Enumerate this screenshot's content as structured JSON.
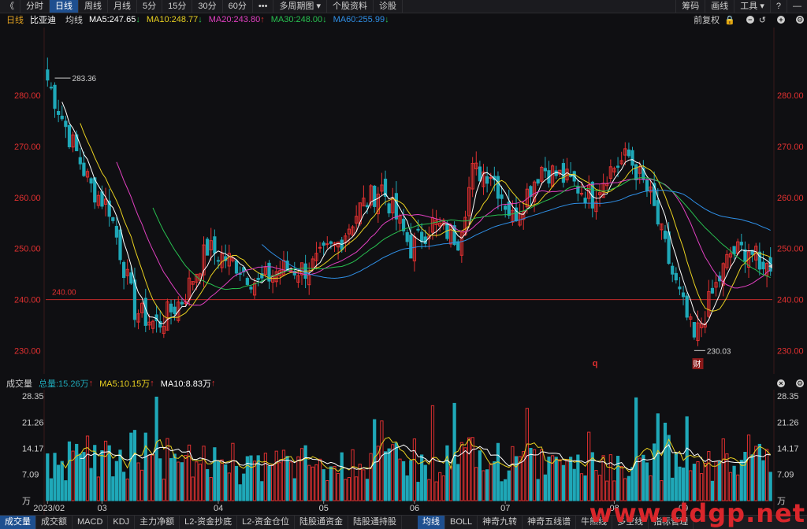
{
  "toolbar": {
    "back_icon": "double-chevron-left-icon",
    "items": [
      "分时",
      "日线",
      "周线",
      "月线",
      "5分",
      "15分",
      "30分",
      "60分",
      "•••",
      "多周期图 ▾",
      "个股资料",
      "诊股"
    ],
    "active": "日线",
    "right_items": [
      "筹码",
      "画线",
      "工具 ▾"
    ],
    "right_icons": [
      "help-icon",
      "minimize-icon"
    ]
  },
  "header": {
    "period": "日线",
    "name": "比亚迪",
    "ma_label": "均线",
    "ma5": "MA5:247.65",
    "ma10": "MA10:248.77",
    "ma20": "MA20:243.80",
    "ma30": "MA30:248.00",
    "ma60": "MA60:255.99",
    "adjust": "前复权",
    "colors": {
      "ma5": "#ffffff",
      "ma10": "#e8d020",
      "ma20": "#e040c0",
      "ma30": "#28c050",
      "ma60": "#2f8fe6",
      "up": "#e03030",
      "down": "#1fa8b8"
    }
  },
  "price_axis": {
    "ticks": [
      "280.00",
      "270.00",
      "260.00",
      "250.00",
      "240.00",
      "230.00"
    ],
    "values": [
      280,
      270,
      260,
      250,
      240,
      230
    ],
    "ymin": 227,
    "ymax": 292,
    "ref_line": {
      "value": 240,
      "label": "240.00"
    },
    "high": {
      "value": 283.36,
      "label": "283.36"
    },
    "low": {
      "value": 230.03,
      "label": "230.03"
    },
    "markers": [
      "q",
      "财"
    ]
  },
  "volume": {
    "title": "成交量",
    "total": "总量:15.26万",
    "ma5": "MA5:10.15万",
    "ma10": "MA10:8.83万",
    "ticks": [
      "28.35",
      "21.26",
      "14.17",
      "7.09",
      "万"
    ],
    "values": [
      28.35,
      21.26,
      14.17,
      7.09,
      0
    ],
    "ymax": 28.35
  },
  "x_labels": [
    "2023/02",
    "03",
    "04",
    "05",
    "06",
    "07",
    "08",
    "09"
  ],
  "x_label_bars": [
    0,
    15,
    47,
    76,
    101,
    126,
    156,
    175
  ],
  "bottom_tabs": [
    "成交量",
    "成交额",
    "MACD",
    "KDJ",
    "主力净额",
    "L2-资金抄底",
    "L2-资金仓位",
    "陆股通资金",
    "陆股通持股"
  ],
  "bottom_tabs_right": [
    "均线",
    "BOLL",
    "神奇九转",
    "神奇五线谱",
    "牛熊线",
    "多空线",
    "指标管理"
  ],
  "bottom_active_left": "成交量",
  "bottom_active_right": "均线",
  "watermark": "www.ddgp.net",
  "chart_data": {
    "type": "candlestick",
    "title": "比亚迪 日线",
    "xlabel": "",
    "ylabel": "",
    "series": [
      {
        "name": "MA5",
        "last": 247.65
      },
      {
        "name": "MA10",
        "last": 248.77
      },
      {
        "name": "MA20",
        "last": 243.8
      },
      {
        "name": "MA30",
        "last": 248.0
      },
      {
        "name": "MA60",
        "last": 255.99
      }
    ],
    "ylim": [
      227,
      292
    ],
    "close_anchors": [
      [
        0,
        283
      ],
      [
        6,
        272
      ],
      [
        12,
        262
      ],
      [
        17,
        258
      ],
      [
        24,
        238
      ],
      [
        30,
        235
      ],
      [
        37,
        240
      ],
      [
        44,
        250
      ],
      [
        52,
        247
      ],
      [
        58,
        243
      ],
      [
        64,
        246
      ],
      [
        72,
        246
      ],
      [
        80,
        251
      ],
      [
        86,
        258
      ],
      [
        92,
        262
      ],
      [
        100,
        250
      ],
      [
        106,
        255
      ],
      [
        113,
        252
      ],
      [
        117,
        265
      ],
      [
        122,
        265
      ],
      [
        128,
        256
      ],
      [
        136,
        266
      ],
      [
        144,
        263
      ],
      [
        150,
        260
      ],
      [
        154,
        265
      ],
      [
        160,
        268
      ],
      [
        166,
        260
      ],
      [
        172,
        245
      ],
      [
        178,
        232
      ],
      [
        183,
        241
      ],
      [
        188,
        249
      ],
      [
        193,
        250
      ],
      [
        196,
        247
      ]
    ],
    "volume_max": 28.35
  }
}
